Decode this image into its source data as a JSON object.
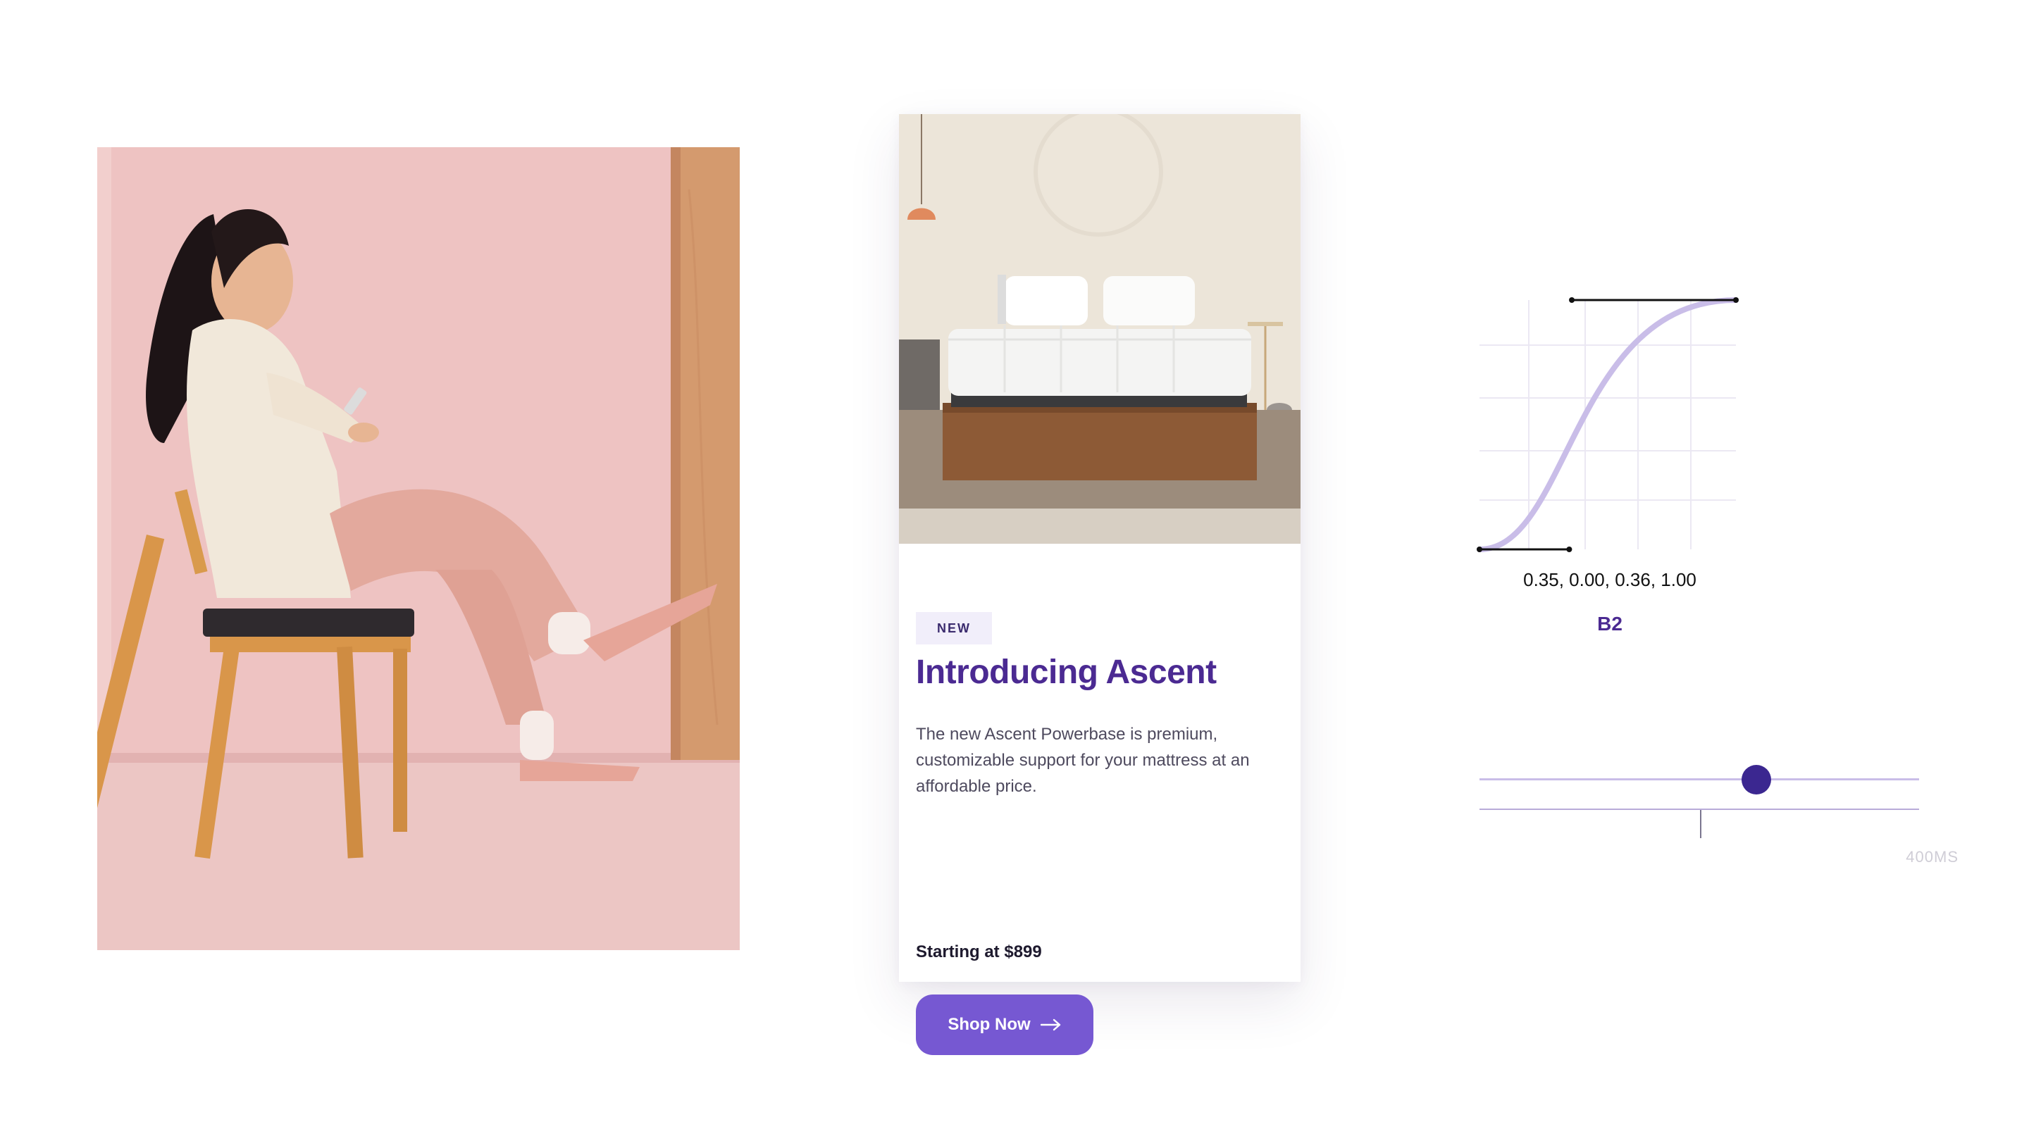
{
  "card": {
    "badge": "NEW",
    "title": "Introducing Ascent",
    "description": "The new Ascent Powerbase is premium, customizable support for your mattress at an affordable price.",
    "price": "Starting at $899",
    "button_label": "Shop Now",
    "button_icon": "arrow-right-icon"
  },
  "easing": {
    "values": "0.35, 0.00, 0.36, 1.00",
    "name": "B2",
    "bezier": [
      0.35,
      0.0,
      0.36,
      1.0
    ],
    "curve_color": "#c9bde8"
  },
  "timeline": {
    "duration_label": "400MS",
    "thumb_color": "#3b2790",
    "progress": 0.63
  },
  "colors": {
    "accent": "#7658d2",
    "title": "#4b2a92",
    "badge_bg": "#f1eefa"
  }
}
